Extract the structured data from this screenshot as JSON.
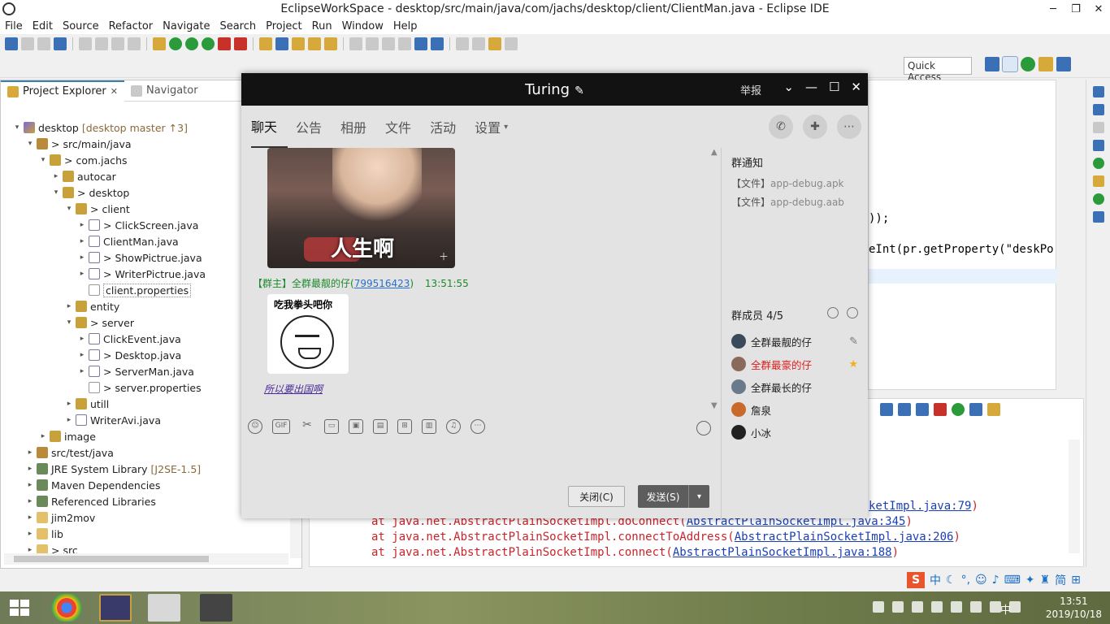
{
  "eclipse": {
    "title": "EclipseWorkSpace - desktop/src/main/java/com/jachs/desktop/client/ClientMan.java - Eclipse IDE",
    "window_controls": [
      "─",
      "❐",
      "✕"
    ],
    "menu": [
      "File",
      "Edit",
      "Source",
      "Refactor",
      "Navigate",
      "Search",
      "Project",
      "Run",
      "Window",
      "Help"
    ],
    "quick_access": "Quick Access",
    "explorer": {
      "tab_project": "Project Explorer",
      "tab_navigator": "Navigator",
      "tree": [
        {
          "label": "desktop",
          "dec": "[desktop master ↑3]",
          "twisty": "▾",
          "icon": "proj",
          "indent": 0
        },
        {
          "label": "> src/main/java",
          "dec": "",
          "twisty": "▾",
          "icon": "pkgroot",
          "indent": 1
        },
        {
          "label": "> com.jachs",
          "dec": "",
          "twisty": "▾",
          "icon": "pkg",
          "indent": 2
        },
        {
          "label": "autocar",
          "dec": "",
          "twisty": "▸",
          "icon": "pkg",
          "indent": 3
        },
        {
          "label": "> desktop",
          "dec": "",
          "twisty": "▾",
          "icon": "pkg",
          "indent": 3
        },
        {
          "label": "> client",
          "dec": "",
          "twisty": "▾",
          "icon": "pkg",
          "indent": 4
        },
        {
          "label": "> ClickScreen.java",
          "dec": "",
          "twisty": "▸",
          "icon": "java",
          "indent": 5
        },
        {
          "label": "ClientMan.java",
          "dec": "",
          "twisty": "▸",
          "icon": "java",
          "indent": 5
        },
        {
          "label": "> ShowPictrue.java",
          "dec": "",
          "twisty": "▸",
          "icon": "java",
          "indent": 5
        },
        {
          "label": "> WriterPictrue.java",
          "dec": "",
          "twisty": "▸",
          "icon": "java",
          "indent": 5
        },
        {
          "label": "client.properties",
          "dec": "",
          "twisty": "",
          "icon": "props",
          "indent": 5,
          "selected": true
        },
        {
          "label": "entity",
          "dec": "",
          "twisty": "▸",
          "icon": "pkg",
          "indent": 4
        },
        {
          "label": "> server",
          "dec": "",
          "twisty": "▾",
          "icon": "pkg",
          "indent": 4
        },
        {
          "label": "ClickEvent.java",
          "dec": "",
          "twisty": "▸",
          "icon": "java",
          "indent": 5
        },
        {
          "label": "> Desktop.java",
          "dec": "",
          "twisty": "▸",
          "icon": "java",
          "indent": 5
        },
        {
          "label": "> ServerMan.java",
          "dec": "",
          "twisty": "▸",
          "icon": "java",
          "indent": 5
        },
        {
          "label": "> server.properties",
          "dec": "",
          "twisty": "",
          "icon": "props",
          "indent": 5
        },
        {
          "label": "utill",
          "dec": "",
          "twisty": "▸",
          "icon": "pkg",
          "indent": 4
        },
        {
          "label": "WriterAvi.java",
          "dec": "",
          "twisty": "▸",
          "icon": "java",
          "indent": 4
        },
        {
          "label": "image",
          "dec": "",
          "twisty": "▸",
          "icon": "pkg",
          "indent": 2
        },
        {
          "label": "src/test/java",
          "dec": "",
          "twisty": "▸",
          "icon": "pkgroot",
          "indent": 1
        },
        {
          "label": "JRE System Library",
          "dec": "[J2SE-1.5]",
          "twisty": "▸",
          "icon": "lib",
          "indent": 1
        },
        {
          "label": "Maven Dependencies",
          "dec": "",
          "twisty": "▸",
          "icon": "lib",
          "indent": 1
        },
        {
          "label": "Referenced Libraries",
          "dec": "",
          "twisty": "▸",
          "icon": "lib",
          "indent": 1
        },
        {
          "label": "jim2mov",
          "dec": "",
          "twisty": "▸",
          "icon": "folder",
          "indent": 1
        },
        {
          "label": "lib",
          "dec": "",
          "twisty": "▸",
          "icon": "folder",
          "indent": 1
        },
        {
          "label": "> src",
          "dec": "",
          "twisty": "▸",
          "icon": "folder",
          "indent": 1
        }
      ]
    },
    "editor_code": [
      "));",
      "eInt(pr.getProperty(\"deskPo"
    ],
    "console_lines": [
      {
        "prefix": "",
        "link": "ketImpl.java:79",
        "suffix": ")"
      },
      {
        "prefix": "at java.net.AbstractPlainSocketImpl.doConnect(",
        "link": "AbstractPlainSocketImpl.java:345",
        "suffix": ")"
      },
      {
        "prefix": "at java.net.AbstractPlainSocketImpl.connectToAddress(",
        "link": "AbstractPlainSocketImpl.java:206",
        "suffix": ")"
      },
      {
        "prefix": "at java.net.AbstractPlainSocketImpl.connect(",
        "link": "AbstractPlainSocketImpl.java:188",
        "suffix": ")"
      }
    ]
  },
  "qq": {
    "title": "Turing",
    "edit_icon": "✎",
    "report": "举报",
    "tabs": [
      "聊天",
      "公告",
      "相册",
      "文件",
      "活动",
      "设置"
    ],
    "sticker1_caption": "人生啊",
    "sender_prefix": "【群主】全群最靓的仔(",
    "sender_qq": "799516423",
    "sender_suffix": ")",
    "sender_time": "13:51:55",
    "sticker2_caption": "吃我拳头吧你",
    "link_message": "所以要出国啊",
    "input_tools": [
      "☺",
      "GIF",
      "✂",
      "▭",
      "▣",
      "▤",
      "⊞",
      "▥",
      "♫",
      "⋯"
    ],
    "close_button": "关闭(C)",
    "send_button": "发送(S)",
    "notice_title": "群通知",
    "notice_files": [
      {
        "prefix": "【文件】",
        "name": "app-debug.apk"
      },
      {
        "prefix": "【文件】",
        "name": "app-debug.aab"
      }
    ],
    "members_title": "群成员 4/5",
    "members": [
      {
        "name": "全群最靓的仔",
        "avatar_color": "#3b4a5a",
        "tag": "✎",
        "owner": false
      },
      {
        "name": "全群最豪的仔",
        "avatar_color": "#8a6a5a",
        "tag": "★",
        "owner": true
      },
      {
        "name": "全群最长的仔",
        "avatar_color": "#6a7a8a",
        "tag": "",
        "owner": false
      },
      {
        "name": "詹泉",
        "avatar_color": "#c96a2a",
        "tag": "",
        "owner": false
      },
      {
        "name": "小冰",
        "avatar_color": "#222222",
        "tag": "",
        "owner": false
      }
    ]
  },
  "ime": {
    "logo": "S",
    "mode": "中"
  },
  "taskbar": {
    "time": "13:51",
    "date": "2019/10/18",
    "ime_indicator": "中"
  }
}
